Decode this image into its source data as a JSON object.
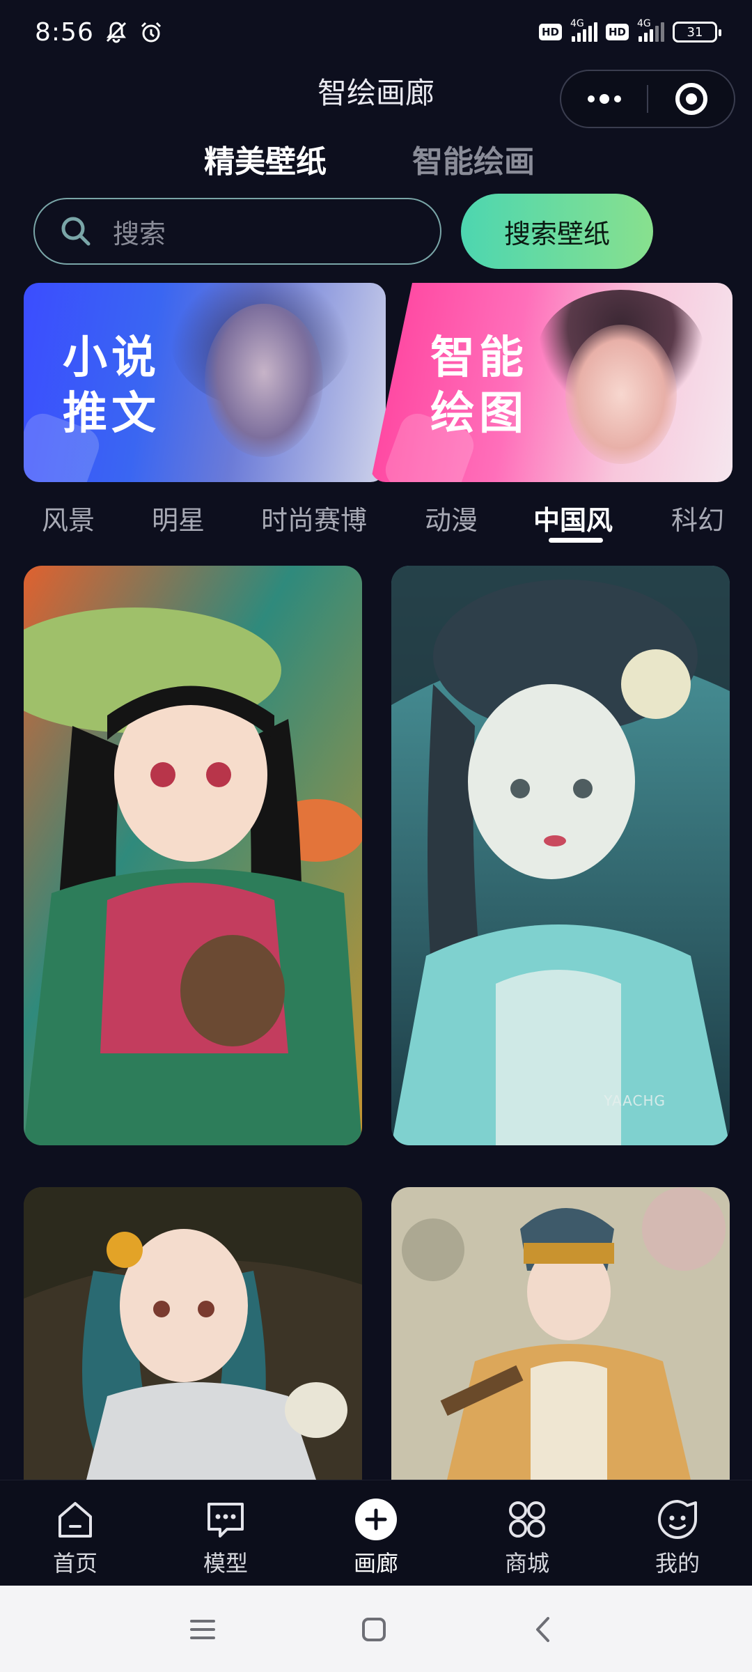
{
  "status_bar": {
    "time": "8:56",
    "hd1": "HD",
    "net1": "4G",
    "hd2": "HD",
    "net2": "4G",
    "battery": "31"
  },
  "header": {
    "title": "智绘画廊"
  },
  "top_tabs": [
    {
      "label": "精美壁纸",
      "active": true
    },
    {
      "label": "智能绘画",
      "active": false
    }
  ],
  "search": {
    "placeholder": "搜索",
    "button_label": "搜索壁纸"
  },
  "banners": [
    {
      "text_line1": "小说",
      "text_line2": "推文"
    },
    {
      "text_line1": "智能",
      "text_line2": "绘图"
    }
  ],
  "categories": [
    {
      "label": "风景"
    },
    {
      "label": "明星"
    },
    {
      "label": "时尚赛博"
    },
    {
      "label": "动漫"
    },
    {
      "label": "中国风",
      "active": true
    },
    {
      "label": "科幻"
    }
  ],
  "gallery": [
    {
      "icon": "mushroom-girl-artwork"
    },
    {
      "icon": "teal-hanfu-girl-artwork"
    },
    {
      "icon": "sunflower-girl-artwork"
    },
    {
      "icon": "opera-girl-artwork"
    }
  ],
  "watermark": "YAACHG",
  "bottom_nav": [
    {
      "label": "首页",
      "icon": "home-icon"
    },
    {
      "label": "模型",
      "icon": "chat-icon"
    },
    {
      "label": "画廊",
      "icon": "plus-icon"
    },
    {
      "label": "商城",
      "icon": "shop-icon"
    },
    {
      "label": "我的",
      "icon": "profile-icon"
    }
  ],
  "colors": {
    "background": "#0d0f1e",
    "accent_start": "#4dd6b0",
    "accent_end": "#88e08e",
    "search_border": "#7aa6a8"
  }
}
